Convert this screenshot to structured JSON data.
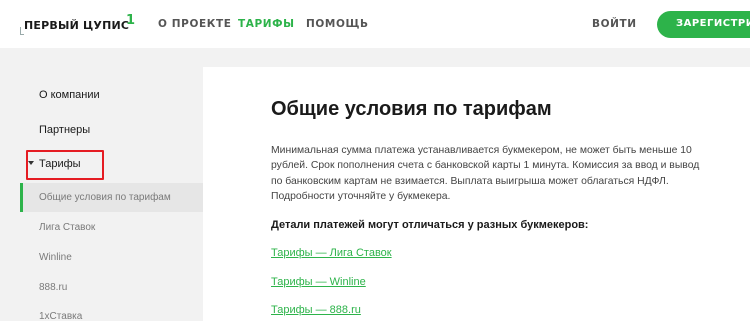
{
  "header": {
    "logo_text": "ПЕРВЫЙ ЦУПИС",
    "logo_superscript": "1",
    "nav": [
      {
        "label": "О ПРОЕКТЕ",
        "active": false
      },
      {
        "label": "ТАРИФЫ",
        "active": true
      },
      {
        "label": "ПОМОЩЬ",
        "active": false
      }
    ],
    "login_label": "ВОЙТИ",
    "register_label": "ЗАРЕГИСТРИР"
  },
  "sidebar": {
    "items": [
      {
        "label": "О компании"
      },
      {
        "label": "Партнеры"
      },
      {
        "label": "Тарифы",
        "expanded": true
      }
    ],
    "sub_items": [
      {
        "label": "Общие условия по тарифам",
        "active": true
      },
      {
        "label": "Лига Ставок"
      },
      {
        "label": "Winline"
      },
      {
        "label": "888.ru"
      },
      {
        "label": "1хСтавка"
      }
    ]
  },
  "main": {
    "title": "Общие условия по тарифам",
    "paragraph_lines": [
      "Минимальная сумма платежа устанавливается букмекером, не может быть меньше 10",
      "рублей. Срок пополнения счета с банковской карты 1 минута. Комиссия за ввод и вывод",
      "по банковским картам не взимается. Выплата выигрыша может облагаться НДФЛ.",
      "Подробности уточняйте у букмекера."
    ],
    "details_heading": "Детали платежей могут отличаться у разных букмекеров:",
    "links": [
      {
        "label": "Тарифы — Лига Ставок"
      },
      {
        "label": "Тарифы — Winline"
      },
      {
        "label": "Тарифы — 888.ru"
      }
    ]
  },
  "colors": {
    "accent": "#2db34a",
    "highlight_box": "#e51c23"
  }
}
